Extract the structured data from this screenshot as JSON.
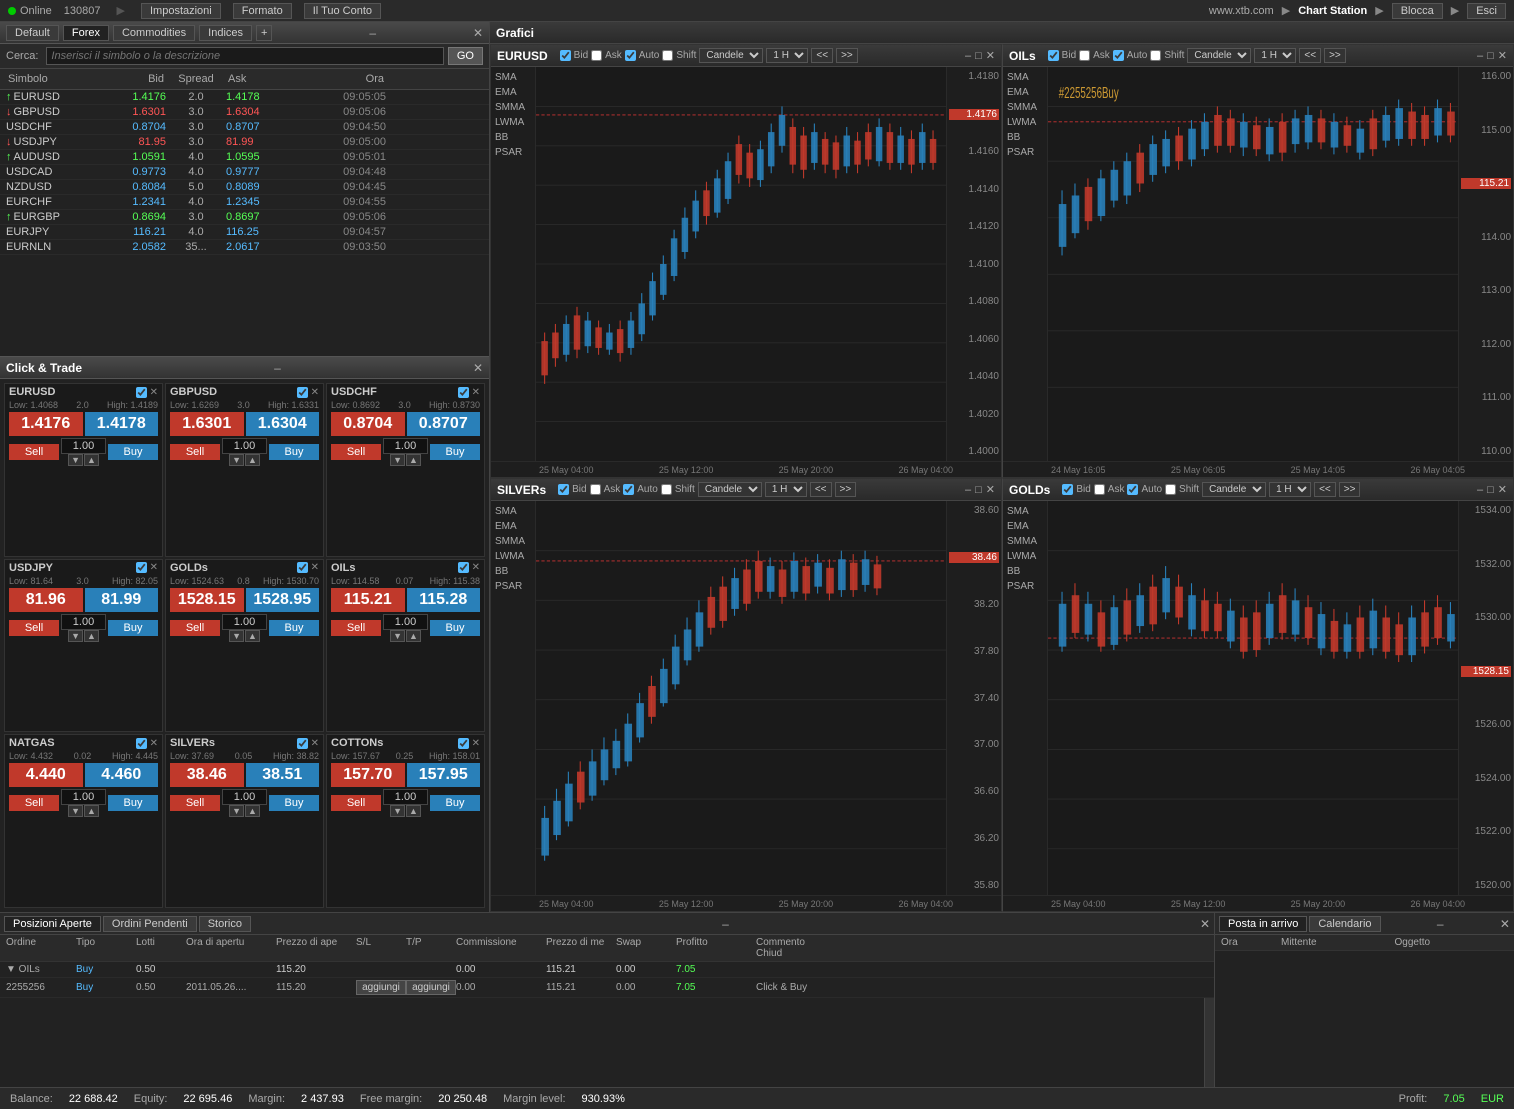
{
  "topbar": {
    "status": "Online",
    "id": "130807",
    "impostazioni": "Impostazioni",
    "formato": "Formato",
    "il_tuo_conto": "Il Tuo Conto",
    "website": "www.xtb.com",
    "chart_station": "Chart Station",
    "blocca": "Blocca",
    "esci": "Esci"
  },
  "watchlist": {
    "tabs": [
      "Default",
      "Forex",
      "Commodities",
      "Indices"
    ],
    "active_tab": "Forex",
    "search_placeholder": "Inserisci il simbolo o la descrizione",
    "go_label": "GO",
    "cerca_label": "Cerca:",
    "columns": [
      "Simbolo",
      "Bid",
      "Spread",
      "Ask",
      "Ora"
    ],
    "rows": [
      {
        "symbol": "EURUSD",
        "direction": "up",
        "bid": "1.4176",
        "spread": "2.0",
        "ask": "1.4178",
        "time": "09:05:05"
      },
      {
        "symbol": "GBPUSD",
        "direction": "down",
        "bid": "1.6301",
        "spread": "3.0",
        "ask": "1.6304",
        "time": "09:05:06"
      },
      {
        "symbol": "USDCHF",
        "direction": "",
        "bid": "0.8704",
        "spread": "3.0",
        "ask": "0.8707",
        "time": "09:04:50"
      },
      {
        "symbol": "USDJPY",
        "direction": "down",
        "bid": "81.95",
        "spread": "3.0",
        "ask": "81.99",
        "time": "09:05:00"
      },
      {
        "symbol": "AUDUSD",
        "direction": "up",
        "bid": "1.0591",
        "spread": "4.0",
        "ask": "1.0595",
        "time": "09:05:01"
      },
      {
        "symbol": "USDCAD",
        "direction": "",
        "bid": "0.9773",
        "spread": "4.0",
        "ask": "0.9777",
        "time": "09:04:48"
      },
      {
        "symbol": "NZDUSD",
        "direction": "",
        "bid": "0.8084",
        "spread": "5.0",
        "ask": "0.8089",
        "time": "09:04:45"
      },
      {
        "symbol": "EURCHF",
        "direction": "",
        "bid": "1.2341",
        "spread": "4.0",
        "ask": "1.2345",
        "time": "09:04:55"
      },
      {
        "symbol": "EURGBP",
        "direction": "up",
        "bid": "0.8694",
        "spread": "3.0",
        "ask": "0.8697",
        "time": "09:05:06"
      },
      {
        "symbol": "EURJPY",
        "direction": "",
        "bid": "116.21",
        "spread": "4.0",
        "ask": "116.25",
        "time": "09:04:57"
      },
      {
        "symbol": "EURNLN",
        "direction": "",
        "bid": "2.0582",
        "spread": "35...",
        "ask": "2.0617",
        "time": "09:03:50"
      }
    ]
  },
  "click_trade": {
    "title": "Click & Trade",
    "cards": [
      {
        "symbol": "EURUSD",
        "low": "1.4068",
        "spread": "2.0",
        "high": "1.4189",
        "sell": "1.4176",
        "buy": "1.4178",
        "lot": "1.00"
      },
      {
        "symbol": "GBPUSD",
        "low": "1.6269",
        "spread": "3.0",
        "high": "1.6331",
        "sell": "1.6301",
        "buy": "1.6304",
        "lot": "1.00"
      },
      {
        "symbol": "USDCHF",
        "low": "0.8692",
        "spread": "3.0",
        "high": "0.8730",
        "sell": "0.8704",
        "buy": "0.8707",
        "lot": "1.00"
      },
      {
        "symbol": "USDJPY",
        "low": "81.64",
        "spread": "3.0",
        "high": "82.05",
        "sell": "81.96",
        "buy": "81.99",
        "lot": "1.00"
      },
      {
        "symbol": "GOLDs",
        "low": "1524.63",
        "spread": "0.8",
        "high": "1530.70",
        "sell": "1528.15",
        "buy": "1528.95",
        "lot": "1.00"
      },
      {
        "symbol": "OILs",
        "low": "114.58",
        "spread": "0.07",
        "high": "115.38",
        "sell": "115.21",
        "buy": "115.28",
        "lot": "1.00"
      },
      {
        "symbol": "NATGAS",
        "low": "4.432",
        "spread": "0.02",
        "high": "4.445",
        "sell": "4.440",
        "buy": "4.460",
        "lot": "1.00"
      },
      {
        "symbol": "SILVERs",
        "low": "37.69",
        "spread": "0.05",
        "high": "38.82",
        "sell": "38.46",
        "buy": "38.51",
        "lot": "1.00"
      },
      {
        "symbol": "COTTONs",
        "low": "157.67",
        "spread": "0.25",
        "high": "158.01",
        "sell": "157.70",
        "buy": "157.95",
        "lot": "1.00"
      }
    ]
  },
  "charts": {
    "grafici_label": "Grafici",
    "panels": [
      {
        "id": "eurusd",
        "symbol": "EURUSD",
        "timeframe": "1 H",
        "type": "Candele",
        "price_high": "1.4190",
        "price_low": "1.4000",
        "current_price": "1.4176",
        "prices": [
          "1.4180",
          "1.4160",
          "1.4140",
          "1.4120",
          "1.4100",
          "1.4080",
          "1.4060",
          "1.4040",
          "1.4020",
          "1.4000"
        ],
        "times": [
          "25 May 04:00",
          "25 May 12:00",
          "25 May 20:00",
          "26 May 04:00"
        ],
        "indicators": [
          "SMA",
          "EMA",
          "SMMA",
          "LWMA",
          "BB",
          "PSAR"
        ]
      },
      {
        "id": "oils",
        "symbol": "OILs",
        "timeframe": "1 H",
        "type": "Candele",
        "price_high": "116.00",
        "price_low": "110.00",
        "current_price": "115.21",
        "prices": [
          "116.00",
          "115.00",
          "114.00",
          "113.00",
          "112.00",
          "111.00",
          "110.00"
        ],
        "times": [
          "24 May 16:05",
          "25 May 06:05",
          "25 May 14:05",
          "26 May 04:05"
        ],
        "indicators": [
          "SMA",
          "EMA",
          "SMMA",
          "LWMA",
          "BB",
          "PSAR"
        ]
      },
      {
        "id": "silvers",
        "symbol": "SILVERs",
        "timeframe": "1 H",
        "type": "Candele",
        "price_high": "38.60",
        "price_low": "35.80",
        "current_price": "38.46",
        "prices": [
          "38.60",
          "38.20",
          "37.80",
          "37.40",
          "37.00",
          "36.60",
          "36.20",
          "35.80"
        ],
        "times": [
          "25 May 04:00",
          "25 May 12:00",
          "25 May 20:00",
          "26 May 04:00"
        ],
        "indicators": [
          "SMA",
          "EMA",
          "SMMA",
          "LWMA",
          "BB",
          "PSAR"
        ]
      },
      {
        "id": "golds",
        "symbol": "GOLDs",
        "timeframe": "1 H",
        "type": "Candele",
        "price_high": "1534.00",
        "price_low": "1520.00",
        "current_price": "1528.15",
        "prices": [
          "1534.00",
          "1532.00",
          "1530.00",
          "1528.00",
          "1526.00",
          "1524.00",
          "1522.00",
          "1520.00"
        ],
        "times": [
          "25 May 04:00",
          "25 May 12:00",
          "25 May 20:00",
          "26 May 04:00"
        ],
        "indicators": [
          "SMA",
          "EMA",
          "SMMA",
          "LWMA",
          "BB",
          "PSAR"
        ]
      }
    ]
  },
  "bottom": {
    "left_tabs": [
      "Posizioni Aperte",
      "Ordini Pendenti",
      "Storico"
    ],
    "active_left_tab": "Posizioni Aperte",
    "right_tabs": [
      "Posta in arrivo",
      "Calendario"
    ],
    "active_right_tab": "Posta in arrivo",
    "columns": [
      "Ordine",
      "Tipo",
      "Lotti",
      "Ora di apertu",
      "Prezzo di ape",
      "S/L",
      "T/P",
      "Commissione",
      "Prezzo di me",
      "Swap",
      "Profitto",
      "Commento",
      "Chiud"
    ],
    "group_row": {
      "symbol": "OILs",
      "type": "Buy",
      "lots": "0.50",
      "price": "115.20",
      "sl": "",
      "tp": "",
      "commission": "0.00",
      "market_price": "115.21",
      "swap": "0.00",
      "profit": "7.05",
      "comment": ""
    },
    "detail_row": {
      "order": "2255256",
      "type": "Buy",
      "lots": "0.50",
      "time": "2011.05.26....",
      "price": "115.20",
      "aggiungi1": "aggiungi",
      "aggiungi2": "aggiungi",
      "commission": "0.00",
      "market_price": "115.21",
      "swap": "0.00",
      "profit": "7.05",
      "comment": "Click & Buy"
    },
    "right_columns": [
      "Ora",
      "Mittente",
      "Oggetto"
    ]
  },
  "status_bar": {
    "balance_label": "Balance:",
    "balance_val": "22 688.42",
    "equity_label": "Equity:",
    "equity_val": "22 695.46",
    "margin_label": "Margin:",
    "margin_val": "2 437.93",
    "free_margin_label": "Free margin:",
    "free_margin_val": "20 250.48",
    "margin_level_label": "Margin level:",
    "margin_level_val": "930.93%",
    "profit_label": "Profit:",
    "profit_val": "7.05",
    "profit_currency": "EUR"
  }
}
